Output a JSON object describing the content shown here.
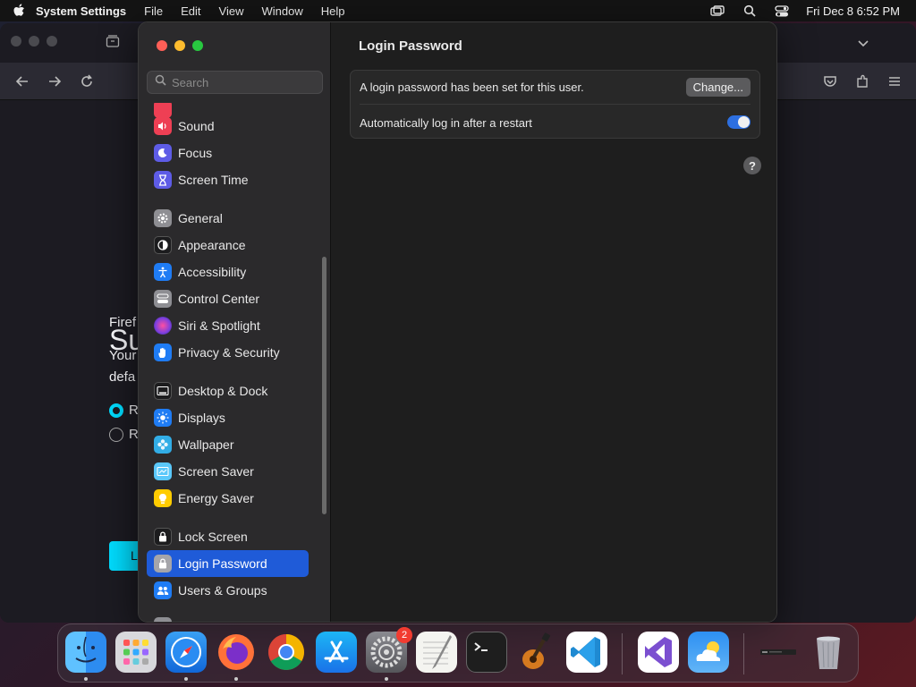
{
  "menubar": {
    "app_name": "System Settings",
    "menus": [
      "File",
      "Edit",
      "View",
      "Window",
      "Help"
    ],
    "datetime": "Fri Dec 8  6:52 PM"
  },
  "firefox_background": {
    "heading": "Su",
    "line1": "Firef",
    "line2a": "Your",
    "line2b": "defa",
    "radio1": "R",
    "radio2": "R",
    "button": "L"
  },
  "settings": {
    "search_placeholder": "Search",
    "sidebar": [
      {
        "label": "Sound",
        "icon": "speaker-icon",
        "color": "#ee3f54"
      },
      {
        "label": "Focus",
        "icon": "moon-icon",
        "color": "#5e5ce6"
      },
      {
        "label": "Screen Time",
        "icon": "hourglass-icon",
        "color": "#5e5ce6"
      },
      {
        "label": "General",
        "icon": "gear-icon",
        "color": "#8e8e93"
      },
      {
        "label": "Appearance",
        "icon": "appearance-icon",
        "color": "#1c1c1e"
      },
      {
        "label": "Accessibility",
        "icon": "accessibility-icon",
        "color": "#1f7cf4"
      },
      {
        "label": "Control Center",
        "icon": "control-center-icon",
        "color": "#8e8e93"
      },
      {
        "label": "Siri & Spotlight",
        "icon": "siri-icon",
        "color": "#b543e0"
      },
      {
        "label": "Privacy & Security",
        "icon": "hand-icon",
        "color": "#1f7cf4"
      },
      {
        "label": "Desktop & Dock",
        "icon": "dock-icon",
        "color": "#1c1c1e"
      },
      {
        "label": "Displays",
        "icon": "sun-icon",
        "color": "#1f7cf4"
      },
      {
        "label": "Wallpaper",
        "icon": "flower-icon",
        "color": "#32ade6"
      },
      {
        "label": "Screen Saver",
        "icon": "screensaver-icon",
        "color": "#5ac8fa"
      },
      {
        "label": "Energy Saver",
        "icon": "bulb-icon",
        "color": "#ffcc00"
      },
      {
        "label": "Lock Screen",
        "icon": "lock-icon",
        "color": "#1c1c1e"
      },
      {
        "label": "Login Password",
        "icon": "padlock-icon",
        "color": "#8e8e93"
      },
      {
        "label": "Users & Groups",
        "icon": "users-icon",
        "color": "#1f7cf4"
      }
    ],
    "selected": "Login Password",
    "main": {
      "title": "Login Password",
      "row1_text": "A login password has been set for this user.",
      "change_button": "Change...",
      "row2_text": "Automatically log in after a restart",
      "auto_login_enabled": true,
      "help": "?"
    }
  },
  "dock": {
    "items": [
      "Finder",
      "Launchpad",
      "Safari",
      "Firefox",
      "Chrome",
      "App Store",
      "System Settings",
      "TextEdit",
      "Terminal",
      "GarageBand",
      "Visual Studio Code",
      "Visual Studio",
      "Weather",
      "Downloads",
      "Trash"
    ],
    "settings_badge": "2"
  }
}
